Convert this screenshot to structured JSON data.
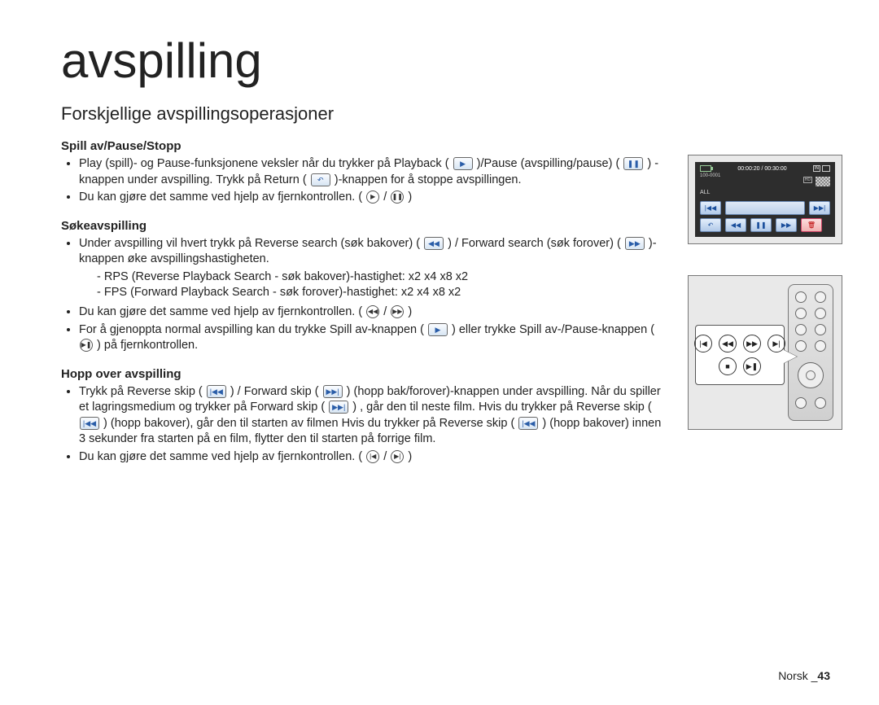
{
  "title": "avspilling",
  "subtitle": "Forskjellige avspillingsoperasjoner",
  "sections": {
    "play": {
      "heading": "Spill av/Pause/Stopp",
      "b1a": "Play (spill)- og Pause-funksjonene veksler når du trykker på Playback (",
      "b1b": ")/Pause (avspilling/pause) (",
      "b1c": ") -knappen under avspilling. Trykk på Return (",
      "b1d": ")-knappen for å stoppe avspillingen.",
      "b2a": "Du kan gjøre det samme ved hjelp av fjernkontrollen. (",
      "b2b": "/",
      "b2c": ")"
    },
    "search": {
      "heading": "Søkeavspilling",
      "b1a": "Under avspilling vil hvert trykk på Reverse search (søk bakover) (",
      "b1b": ") / Forward search (søk forover) (",
      "b1c": ")-knappen øke avspillingshastigheten.",
      "d1": "RPS (Reverse Playback Search - søk bakover)-hastighet: x2      x4      x8      x2",
      "d2": "FPS (Forward Playback Search - søk forover)-hastighet: x2      x4      x8      x2",
      "b2a": "Du kan gjøre det samme ved hjelp av fjernkontrollen. (",
      "b2b": "/",
      "b2c": ")",
      "b3a": "For å gjenoppta normal avspilling kan du trykke Spill av-knappen (",
      "b3b": ") eller trykke Spill av-/Pause-knappen (",
      "b3c": ") på fjernkontrollen."
    },
    "skip": {
      "heading": "Hopp over avspilling",
      "b1a": "Trykk på Reverse skip (",
      "b1b": ") / Forward skip (",
      "b1c": ") (hopp bak/forover)-knappen under avspilling. Når du spiller et lagringsmedium og trykker på Forward skip (",
      "b1d": ") , går den til neste film. Hvis du trykker på Reverse skip (",
      "b1e": ") (hopp bakover), går den til starten av filmen Hvis du trykker på Reverse skip (",
      "b1f": ") (hopp bakover) innen 3 sekunder fra starten på en film, flytter den til starten på forrige film.",
      "b2a": "Du kan gjøre det samme ved hjelp av fjernkontrollen. (",
      "b2b": "/",
      "b2c": ")"
    }
  },
  "lcd": {
    "timecode": "00:00:20 / 00:30:00",
    "counter": "100-0001",
    "label_all": "ALL"
  },
  "footer": {
    "lang": "Norsk _",
    "page": "43"
  }
}
